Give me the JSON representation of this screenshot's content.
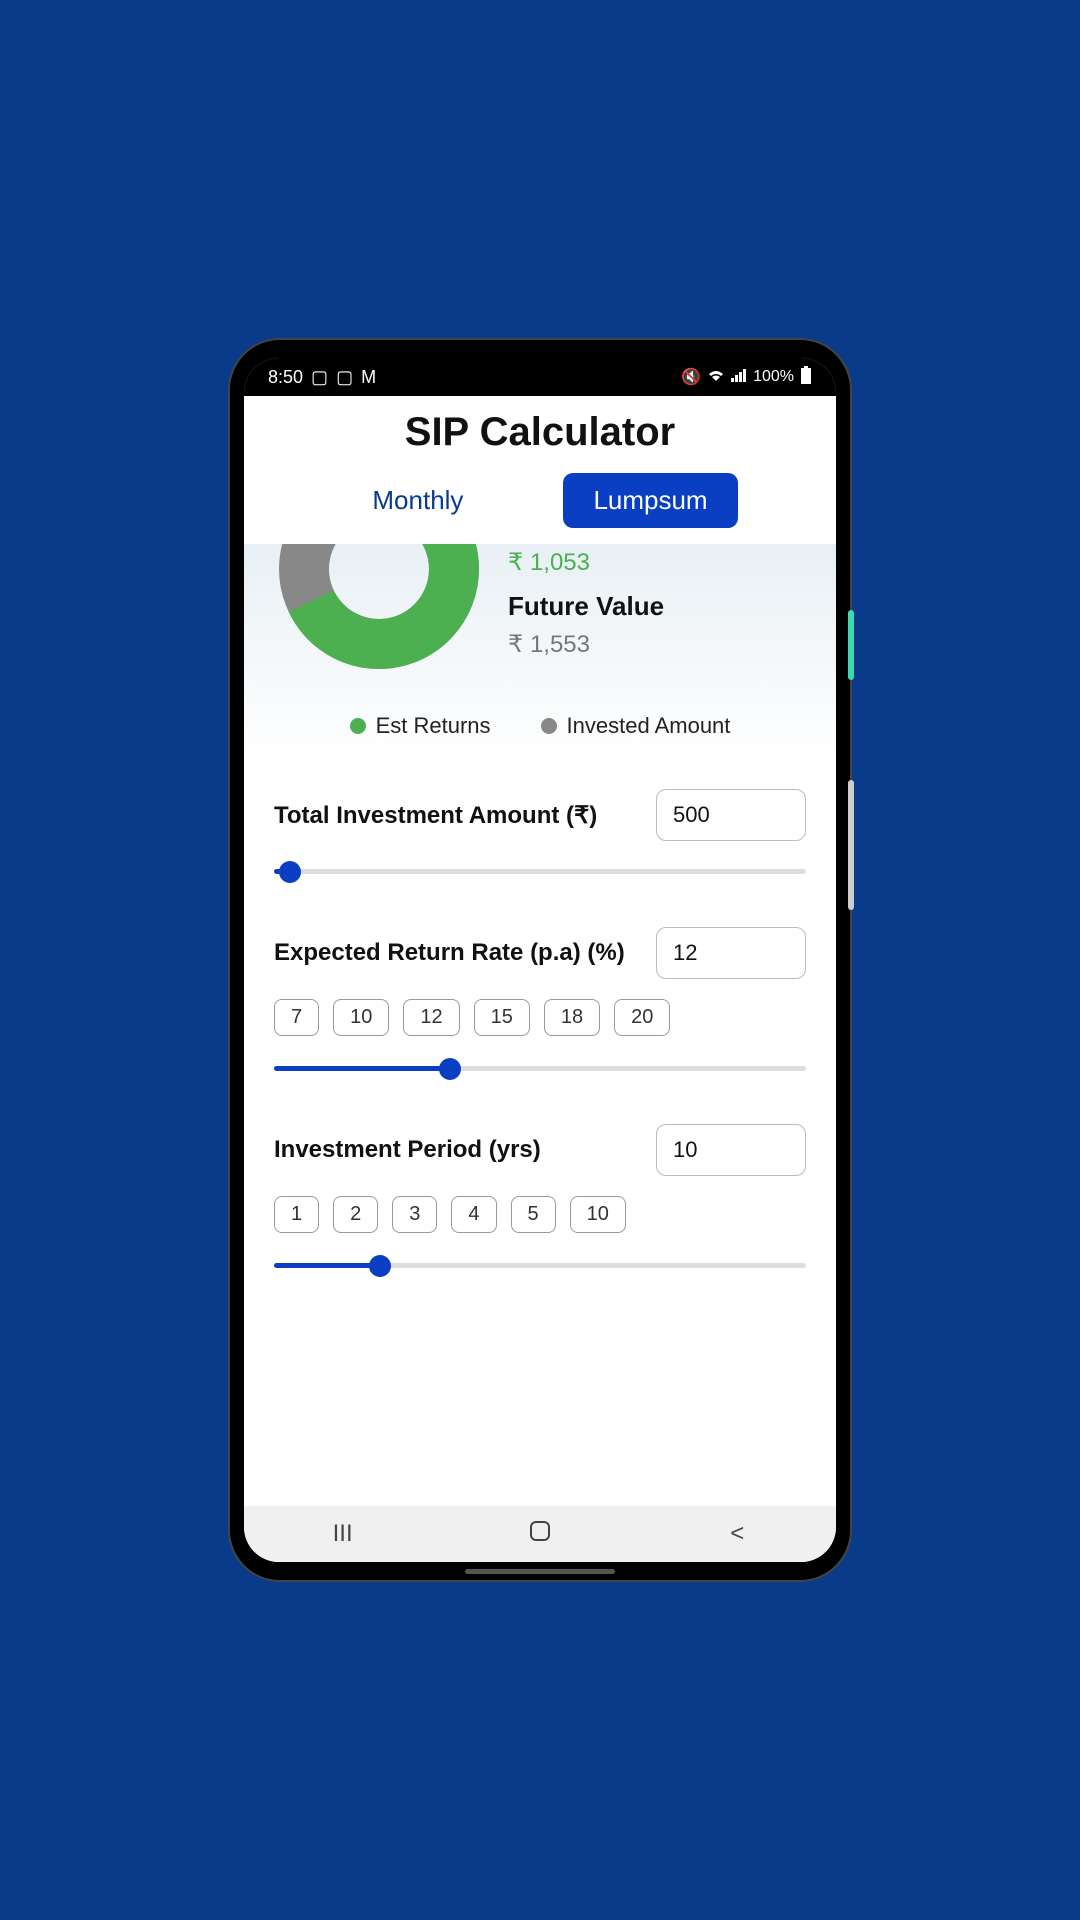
{
  "status": {
    "time": "8:50",
    "battery": "100%"
  },
  "header": {
    "title": "SIP Calculator"
  },
  "tabs": {
    "monthly": "Monthly",
    "lumpsum": "Lumpsum"
  },
  "chart": {
    "returns_value": "₹ 1,053",
    "future_label": "Future Value",
    "future_value": "₹ 1,553",
    "legend_returns": "Est Returns",
    "legend_invested": "Invested Amount"
  },
  "chart_data": {
    "type": "pie",
    "title": "",
    "series": [
      {
        "name": "Est Returns",
        "value": 1053,
        "color": "#4caf50"
      },
      {
        "name": "Invested Amount",
        "value": 500,
        "color": "#888888"
      }
    ],
    "future_value": 1553
  },
  "inputs": {
    "investment": {
      "label": "Total Investment Amount (₹)",
      "value": "500",
      "slider_percent": 3
    },
    "return_rate": {
      "label": "Expected Return Rate (p.a) (%)",
      "value": "12",
      "chips": [
        "7",
        "10",
        "12",
        "15",
        "18",
        "20"
      ],
      "slider_percent": 33
    },
    "period": {
      "label": "Investment Period (yrs)",
      "value": "10",
      "chips": [
        "1",
        "2",
        "3",
        "4",
        "5",
        "10"
      ],
      "slider_percent": 20
    }
  }
}
